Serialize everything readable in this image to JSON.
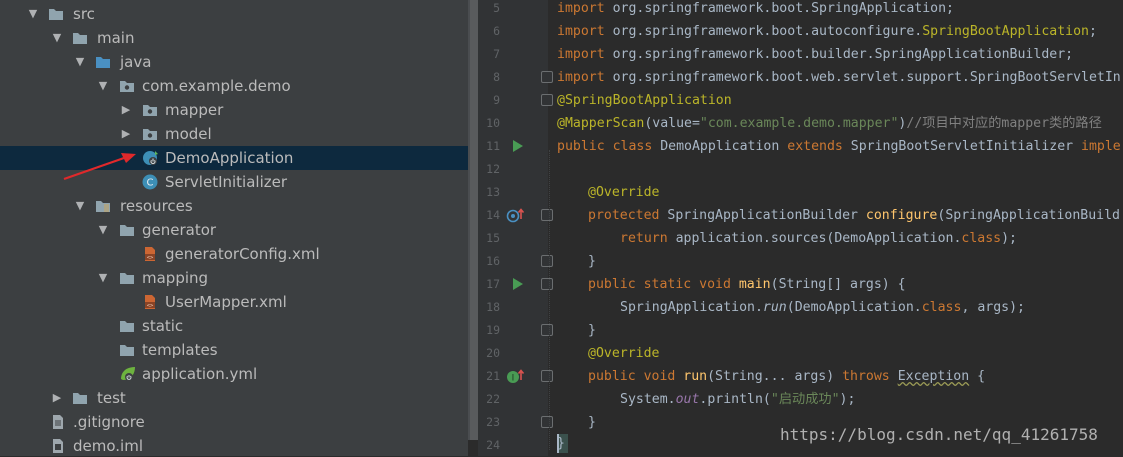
{
  "project_tree": {
    "items": [
      {
        "label": "src",
        "icon": "source-folder-icon",
        "expanded": true
      },
      {
        "label": "main",
        "icon": "folder-icon",
        "expanded": true
      },
      {
        "label": "java",
        "icon": "source-root-icon",
        "expanded": true
      },
      {
        "label": "com.example.demo",
        "icon": "package-icon",
        "expanded": true
      },
      {
        "label": "mapper",
        "icon": "package-icon",
        "expanded": false
      },
      {
        "label": "model",
        "icon": "package-icon",
        "expanded": false
      },
      {
        "label": "DemoApplication",
        "icon": "spring-boot-class-icon",
        "selected": true
      },
      {
        "label": "ServletInitializer",
        "icon": "class-icon"
      },
      {
        "label": "resources",
        "icon": "resources-folder-icon",
        "expanded": true
      },
      {
        "label": "generator",
        "icon": "folder-icon",
        "expanded": true
      },
      {
        "label": "generatorConfig.xml",
        "icon": "xml-file-icon"
      },
      {
        "label": "mapping",
        "icon": "folder-icon",
        "expanded": true
      },
      {
        "label": "UserMapper.xml",
        "icon": "xml-file-icon"
      },
      {
        "label": "static",
        "icon": "folder-icon"
      },
      {
        "label": "templates",
        "icon": "folder-icon"
      },
      {
        "label": "application.yml",
        "icon": "yaml-spring-icon"
      },
      {
        "label": "test",
        "icon": "folder-icon",
        "expanded": false
      },
      {
        "label": ".gitignore",
        "icon": "text-file-icon"
      },
      {
        "label": "demo.iml",
        "icon": "iml-file-icon"
      }
    ]
  },
  "editor": {
    "line_numbers": [
      "5",
      "6",
      "7",
      "8",
      "9",
      "10",
      "11",
      "12",
      "13",
      "14",
      "15",
      "16",
      "17",
      "18",
      "19",
      "20",
      "21",
      "22",
      "23",
      "24"
    ],
    "lines": {
      "l5": {
        "kw": "import",
        "rest": " org.springframework.boot.SpringApplication;"
      },
      "l6": {
        "kw": "import",
        "rest": " org.springframework.boot.autoconfigure.",
        "ann": "SpringBootApplication",
        "end": ";"
      },
      "l7": {
        "kw": "import",
        "rest": " org.springframework.boot.builder.SpringApplicationBuilder;"
      },
      "l8": {
        "kw": "import",
        "rest": " org.springframework.boot.web.servlet.support.SpringBootServletIn"
      },
      "l9": {
        "ann": "@SpringBootApplication"
      },
      "l10": {
        "ann": "@MapperScan",
        "a": "(value=",
        "str": "\"com.example.demo.mapper\"",
        "b": ")",
        "cmt": "//项目中对应的mapper类的路径"
      },
      "l11": {
        "kw1": "public class",
        "name": " DemoApplication ",
        "kw2": "extends",
        "rest": " SpringBootServletInitializer ",
        "kw3": "imple"
      },
      "l13": {
        "ann": "@Override"
      },
      "l14": {
        "kw": "protected",
        "a": " SpringApplicationBuilder ",
        "fn": "configure",
        "b": "(SpringApplicationBuild"
      },
      "l15": {
        "kw": "return",
        "a": " application.sources(DemoApplication.",
        "kw2": "class",
        "b": ");"
      },
      "l16": {
        "text": "}"
      },
      "l17": {
        "kw": "public static void",
        "fn": " main",
        "b": "(String[] args) {"
      },
      "l18": {
        "a": "SpringApplication.",
        "ital": "run",
        "b": "(DemoApplication.",
        "kw2": "class",
        "c": ", args);"
      },
      "l19": {
        "text": "}"
      },
      "l20": {
        "ann": "@Override"
      },
      "l21": {
        "kw": "public void",
        "fn": " run",
        "a": "(String... args) ",
        "kw2": "throws",
        "warn": "Exception",
        "b": " {"
      },
      "l22": {
        "a": "System.",
        "stat": "out",
        "b": ".println(",
        "str": "\"启动成功\"",
        "c": ");"
      },
      "l23": {
        "text": "}"
      },
      "l24": {
        "text": "}"
      }
    }
  },
  "watermark": "https://blog.csdn.net/qq_41261758",
  "colors": {
    "tree_bg": "#3c3f41",
    "editor_bg": "#2b2b2b",
    "selection": "#0d293e",
    "keyword": "#cc7832",
    "annotation": "#bbb529",
    "string": "#6a8759",
    "annotation_arrow": "#e0292b"
  }
}
